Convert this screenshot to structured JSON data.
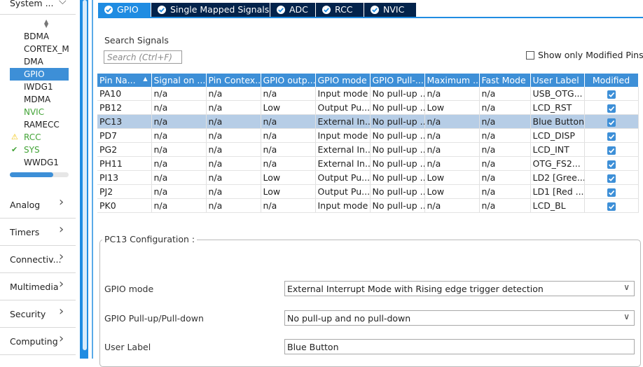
{
  "sidebar": {
    "header": {
      "label": "System ...",
      "chevron": "chevron-down-icon"
    },
    "peripherals": [
      {
        "label": "BDMA",
        "status": "none"
      },
      {
        "label": "CORTEX_M",
        "status": "none"
      },
      {
        "label": "DMA",
        "status": "none"
      },
      {
        "label": "GPIO",
        "status": "selected"
      },
      {
        "label": "IWDG1",
        "status": "none"
      },
      {
        "label": "MDMA",
        "status": "none"
      },
      {
        "label": "NVIC",
        "status": "enabled"
      },
      {
        "label": "RAMECC",
        "status": "none"
      },
      {
        "label": "RCC",
        "status": "warning"
      },
      {
        "label": "SYS",
        "status": "ok"
      },
      {
        "label": "WWDG1",
        "status": "none"
      }
    ],
    "categories": [
      {
        "label": "Analog"
      },
      {
        "label": "Timers"
      },
      {
        "label": "Connectiv..."
      },
      {
        "label": "Multimedia"
      },
      {
        "label": "Security"
      },
      {
        "label": "Computing"
      }
    ]
  },
  "tabs": [
    {
      "label": "GPIO",
      "active": true
    },
    {
      "label": "Single Mapped Signals",
      "active": false
    },
    {
      "label": "ADC",
      "active": false
    },
    {
      "label": "RCC",
      "active": false
    },
    {
      "label": "NVIC",
      "active": false
    }
  ],
  "search": {
    "title": "Search Signals",
    "placeholder": "Search (Ctrl+F)"
  },
  "modified_filter": {
    "label": "Show only Modified Pins",
    "checked": false
  },
  "table": {
    "columns": [
      "Pin Na...",
      "Signal on ...",
      "Pin Contex...",
      "GPIO outp...",
      "GPIO mode",
      "GPIO Pull-...",
      "Maximum ...",
      "Fast Mode",
      "User Label",
      "Modified"
    ],
    "rows": [
      {
        "cells": [
          "PA10",
          "n/a",
          "n/a",
          "n/a",
          "Input mode",
          "No pull-up ...",
          "n/a",
          "n/a",
          "USB_OTG..."
        ],
        "modified": true,
        "selected": false
      },
      {
        "cells": [
          "PB12",
          "n/a",
          "n/a",
          "Low",
          "Output Pu...",
          "No pull-up ...",
          "Low",
          "n/a",
          "LCD_RST"
        ],
        "modified": true,
        "selected": false
      },
      {
        "cells": [
          "PC13",
          "n/a",
          "n/a",
          "n/a",
          "External In...",
          "No pull-up ...",
          "n/a",
          "n/a",
          "Blue Button"
        ],
        "modified": true,
        "selected": true
      },
      {
        "cells": [
          "PD7",
          "n/a",
          "n/a",
          "n/a",
          "Input mode",
          "No pull-up ...",
          "n/a",
          "n/a",
          "LCD_DISP"
        ],
        "modified": true,
        "selected": false
      },
      {
        "cells": [
          "PG2",
          "n/a",
          "n/a",
          "n/a",
          "External In...",
          "No pull-up ...",
          "n/a",
          "n/a",
          "LCD_INT"
        ],
        "modified": true,
        "selected": false
      },
      {
        "cells": [
          "PH11",
          "n/a",
          "n/a",
          "n/a",
          "External In...",
          "No pull-up ...",
          "n/a",
          "n/a",
          "OTG_FS2..."
        ],
        "modified": true,
        "selected": false
      },
      {
        "cells": [
          "PI13",
          "n/a",
          "n/a",
          "Low",
          "Output Pu...",
          "No pull-up ...",
          "Low",
          "n/a",
          "LD2 [Gree..."
        ],
        "modified": true,
        "selected": false
      },
      {
        "cells": [
          "PJ2",
          "n/a",
          "n/a",
          "Low",
          "Output Pu...",
          "No pull-up ...",
          "Low",
          "n/a",
          "LD1 [Red ..."
        ],
        "modified": true,
        "selected": false
      },
      {
        "cells": [
          "PK0",
          "n/a",
          "n/a",
          "n/a",
          "Input mode",
          "No pull-up ...",
          "n/a",
          "n/a",
          "LCD_BL"
        ],
        "modified": true,
        "selected": false
      }
    ]
  },
  "config": {
    "title": "PC13 Configuration :",
    "fields": [
      {
        "label": "GPIO mode",
        "value": "External Interrupt Mode with Rising edge trigger detection",
        "type": "dropdown"
      },
      {
        "label": "GPIO Pull-up/Pull-down",
        "value": "No pull-up and no pull-down",
        "type": "dropdown"
      },
      {
        "label": "User Label",
        "value": "Blue Button",
        "type": "text"
      }
    ]
  },
  "colors": {
    "accent": "#3d8fd7",
    "tab_bg": "#03234b",
    "tab_active": "#1f8ce2",
    "selected_row": "#b6cde6",
    "highlight": "#fafa3c",
    "green": "#43a437",
    "warning": "#f1c40f"
  }
}
